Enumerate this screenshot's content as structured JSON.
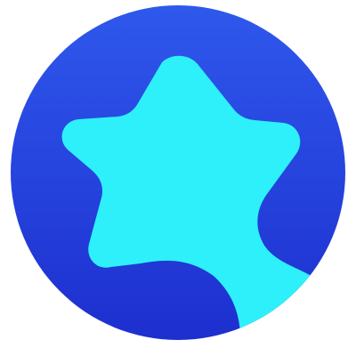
{
  "app_icon": {
    "icon": "star-badge-icon",
    "colors": {
      "background": "#ffffff",
      "circle_top": "#2f58ec",
      "circle_bottom": "#1d2fcf",
      "star": "#2ef0fb"
    }
  }
}
